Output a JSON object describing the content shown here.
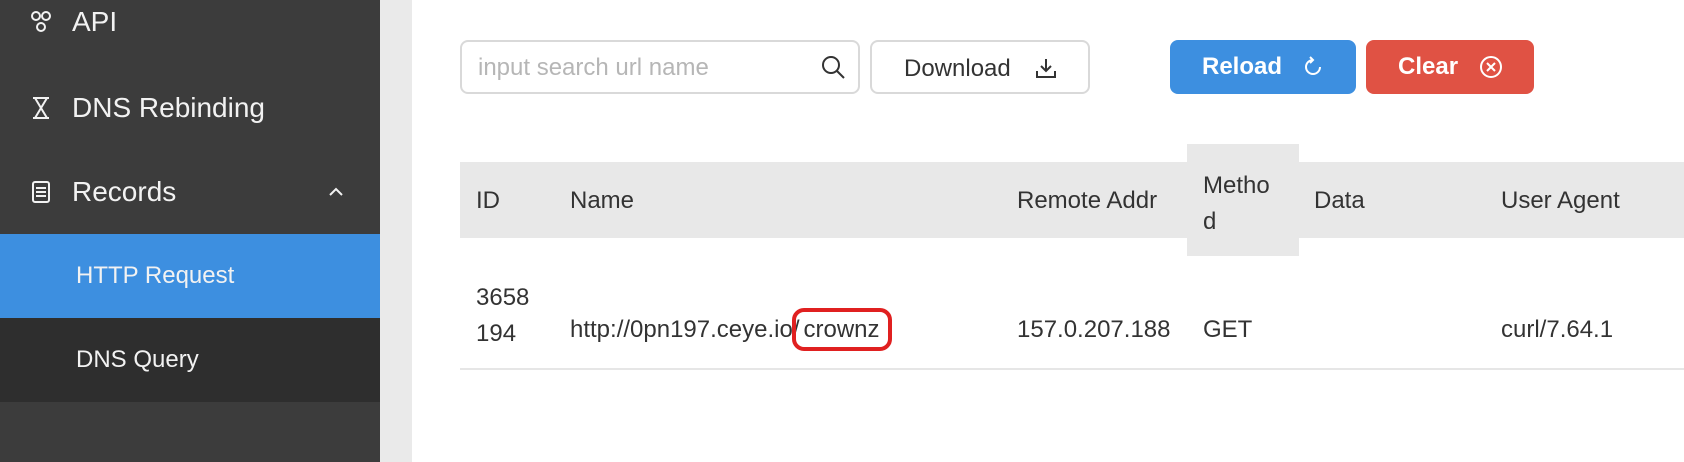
{
  "sidebar": {
    "items": [
      {
        "label": "API",
        "icon": "api-icon"
      },
      {
        "label": "DNS Rebinding",
        "icon": "hourglass-icon"
      },
      {
        "label": "Records",
        "icon": "records-icon",
        "expanded": true
      }
    ],
    "submenu": [
      {
        "label": "HTTP Request",
        "active": true
      },
      {
        "label": "DNS Query",
        "active": false
      }
    ]
  },
  "toolbar": {
    "search": {
      "placeholder": "input search url name",
      "value": ""
    },
    "download_label": "Download",
    "reload_label": "Reload",
    "clear_label": "Clear"
  },
  "table": {
    "columns": [
      "ID",
      "Name",
      "Remote Addr",
      "Method",
      "Data",
      "User Agent"
    ],
    "rows": [
      {
        "id": "3658194",
        "name_prefix": "http://0pn197.ceye.io/",
        "name_highlight": "crownz",
        "remote_addr": "157.0.207.188",
        "method": "GET",
        "data": "",
        "user_agent": "curl/7.64.1"
      }
    ]
  },
  "colors": {
    "sidebar_bg": "#3c3c3c",
    "active_item": "#3d8fe0",
    "reload_button": "#3d8fe0",
    "clear_button": "#e05244",
    "highlight_box": "#e02020"
  }
}
